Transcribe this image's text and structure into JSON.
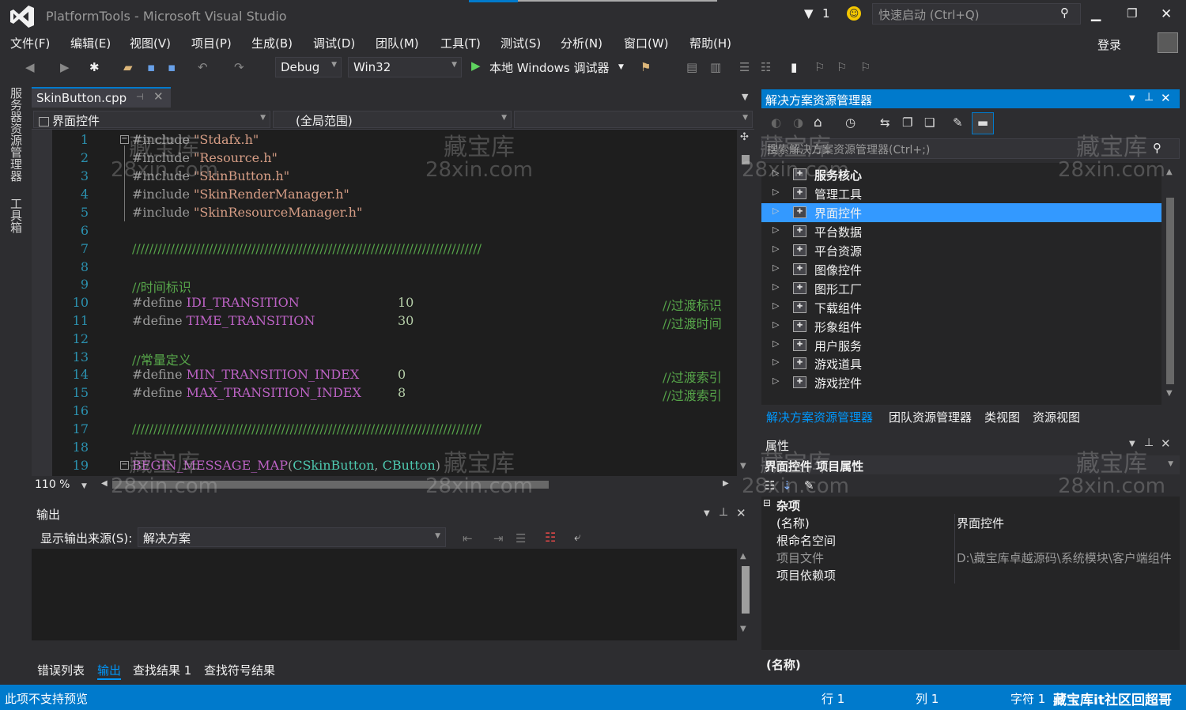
{
  "titlebar": {
    "app_title": "PlatformTools - Microsoft Visual Studio",
    "notification_count": "1",
    "quick_launch_placeholder": "快速启动 (Ctrl+Q)"
  },
  "menu": [
    "文件(F)",
    "编辑(E)",
    "视图(V)",
    "项目(P)",
    "生成(B)",
    "调试(D)",
    "团队(M)",
    "工具(T)",
    "测试(S)",
    "分析(N)",
    "窗口(W)",
    "帮助(H)"
  ],
  "account": {
    "login_label": "登录"
  },
  "toolbar": {
    "config": "Debug",
    "platform": "Win32",
    "debugger": "本地 Windows 调试器"
  },
  "left_dock": {
    "server_explorer": "服务器资源管理器",
    "toolbox": "工具箱"
  },
  "editor": {
    "tab_title": "SkinButton.cpp",
    "nav_scope": "界面控件",
    "nav_member": "(全局范围)",
    "zoom": "110 %",
    "lines": [
      {
        "no": "1",
        "code": "#include \"Stdafx.h\""
      },
      {
        "no": "2",
        "code": "#include \"Resource.h\""
      },
      {
        "no": "3",
        "code": "#include \"SkinButton.h\""
      },
      {
        "no": "4",
        "code": "#include \"SkinRenderManager.h\""
      },
      {
        "no": "5",
        "code": "#include \"SkinResourceManager.h\""
      },
      {
        "no": "6",
        "code": ""
      },
      {
        "no": "7",
        "code": "//////////////////////////////////////////////////////////////////////////////////"
      },
      {
        "no": "8",
        "code": ""
      },
      {
        "no": "9",
        "code": "//时间标识"
      },
      {
        "no": "10",
        "code": "#define IDI_TRANSITION 10 //过渡标识"
      },
      {
        "no": "11",
        "code": "#define TIME_TRANSITION 30 //过渡时间"
      },
      {
        "no": "12",
        "code": ""
      },
      {
        "no": "13",
        "code": "//常量定义"
      },
      {
        "no": "14",
        "code": "#define MIN_TRANSITION_INDEX 0 //过渡索引"
      },
      {
        "no": "15",
        "code": "#define MAX_TRANSITION_INDEX 8 //过渡索引"
      },
      {
        "no": "16",
        "code": ""
      },
      {
        "no": "17",
        "code": "//////////////////////////////////////////////////////////////////////////////////"
      },
      {
        "no": "18",
        "code": ""
      },
      {
        "no": "19",
        "code": "BEGIN_MESSAGE_MAP(CSkinButton, CButton)"
      }
    ],
    "tokens": {
      "l1_kw": "#include",
      "l1_str": "\"Stdafx.h\"",
      "l2_kw": "#include",
      "l2_str": "\"Resource.h\"",
      "l3_kw": "#include",
      "l3_str": "\"SkinButton.h\"",
      "l4_kw": "#include",
      "l4_str": "\"SkinRenderManager.h\"",
      "l5_kw": "#include",
      "l5_str": "\"SkinResourceManager.h\"",
      "l7": "//////////////////////////////////////////////////////////////////////////////////",
      "l9": "//时间标识",
      "l10_kw": "#define",
      "l10_mac": "IDI_TRANSITION",
      "l10_num": "10",
      "l10_cmt": "//过渡标识",
      "l11_kw": "#define",
      "l11_mac": "TIME_TRANSITION",
      "l11_num": "30",
      "l11_cmt": "//过渡时间",
      "l13": "//常量定义",
      "l14_kw": "#define",
      "l14_mac": "MIN_TRANSITION_INDEX",
      "l14_num": "0",
      "l14_cmt": "//过渡索引",
      "l15_kw": "#define",
      "l15_mac": "MAX_TRANSITION_INDEX",
      "l15_num": "8",
      "l15_cmt": "//过渡索引",
      "l17": "//////////////////////////////////////////////////////////////////////////////////",
      "l19_mac": "BEGIN_MESSAGE_MAP",
      "l19_a": "(",
      "l19_typ1": "CSkinButton",
      "l19_b": ", ",
      "l19_typ2": "CButton",
      "l19_c": ")"
    }
  },
  "output": {
    "title": "输出",
    "source_label": "显示输出来源(S):",
    "source_value": "解决方案",
    "bottom_tabs": [
      "错误列表",
      "输出",
      "查找结果 1",
      "查找符号结果"
    ]
  },
  "solution_explorer": {
    "title": "解决方案资源管理器",
    "search_placeholder": "搜索解决方案资源管理器(Ctrl+;)",
    "items": [
      "服务核心",
      "管理工具",
      "界面控件",
      "平台数据",
      "平台资源",
      "图像控件",
      "图形工厂",
      "下载组件",
      "形象组件",
      "用户服务",
      "游戏道具",
      "游戏控件"
    ],
    "selected": "界面控件",
    "tabs": [
      "解决方案资源管理器",
      "团队资源管理器",
      "类视图",
      "资源视图"
    ]
  },
  "properties": {
    "title": "属性",
    "object": "界面控件 项目属性",
    "category": "杂项",
    "rows": [
      {
        "name": "(名称)",
        "value": "界面控件"
      },
      {
        "name": "根命名空间",
        "value": ""
      },
      {
        "name": "项目文件",
        "value": "D:\\藏宝库卓越源码\\系统模块\\客户端组件"
      },
      {
        "name": "项目依赖项",
        "value": ""
      }
    ],
    "desc_title": "(名称)"
  },
  "statusbar": {
    "message": "此项不支持预览",
    "line": "行 1",
    "col": "列 1",
    "char": "字符 1",
    "brand": "藏宝库it社区回超哥"
  },
  "watermark": {
    "line1": "藏宝库",
    "line2": "28xin.com"
  },
  "colors": {
    "accent": "#007acc",
    "selection": "#3399ff",
    "background": "#2d2d30",
    "editor_bg": "#1e1e1e"
  }
}
